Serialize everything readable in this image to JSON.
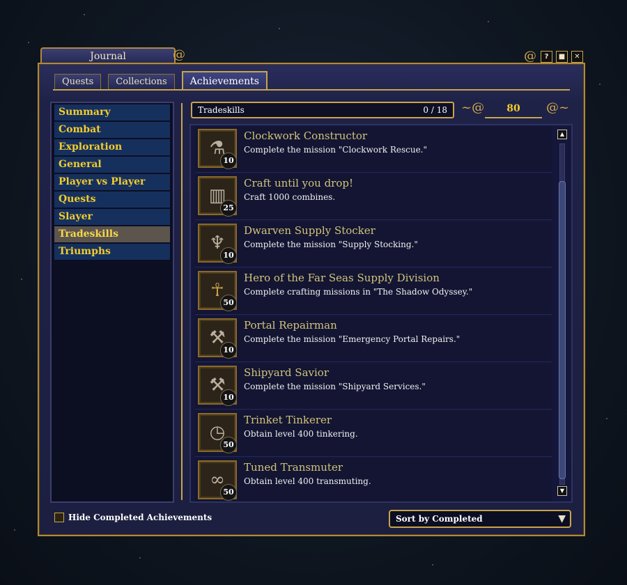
{
  "window": {
    "title": "Journal",
    "buttons": [
      "?",
      "■",
      "✕"
    ]
  },
  "tabs": [
    {
      "label": "Quests"
    },
    {
      "label": "Collections"
    },
    {
      "label": "Achievements",
      "active": true
    }
  ],
  "sidebar": {
    "items": [
      {
        "label": "Summary"
      },
      {
        "label": "Combat"
      },
      {
        "label": "Exploration"
      },
      {
        "label": "General"
      },
      {
        "label": "Player vs Player"
      },
      {
        "label": "Quests"
      },
      {
        "label": "Slayer"
      },
      {
        "label": "Tradeskills",
        "active": true
      },
      {
        "label": "Triumphs"
      }
    ]
  },
  "category": {
    "name": "Tradeskills",
    "progress": "0 / 18"
  },
  "points": "80",
  "achievements": [
    {
      "title": "Clockwork Constructor",
      "description": "Complete the mission \"Clockwork Rescue.\"",
      "points": "10",
      "icon": "vial-icon"
    },
    {
      "title": "Craft until you drop!",
      "description": "Craft 1000 combines.",
      "points": "25",
      "icon": "cabinet-icon"
    },
    {
      "title": "Dwarven Supply Stocker",
      "description": "Complete the mission \"Supply Stocking.\"",
      "points": "10",
      "icon": "lantern-icon"
    },
    {
      "title": "Hero of the Far Seas Supply Division",
      "description": "Complete crafting missions in \"The Shadow Odyssey.\"",
      "points": "50",
      "icon": "hooded-figure-icon"
    },
    {
      "title": "Portal Repairman",
      "description": "Complete the mission \"Emergency Portal Repairs.\"",
      "points": "10",
      "icon": "tools-icon"
    },
    {
      "title": "Shipyard Savior",
      "description": "Complete the mission \"Shipyard Services.\"",
      "points": "10",
      "icon": "hammer-icon"
    },
    {
      "title": "Trinket Tinkerer",
      "description": "Obtain level 400 tinkering.",
      "points": "50",
      "icon": "clock-icon"
    },
    {
      "title": "Tuned Transmuter",
      "description": "Obtain level 400 transmuting.",
      "points": "50",
      "icon": "orbs-icon"
    }
  ],
  "footer": {
    "hide_completed_label": "Hide Completed Achievements",
    "sort_label": "Sort by Completed"
  },
  "colors": {
    "gold": "#c9a54c",
    "sidebar_text": "#f2cc2c",
    "achievement_title": "#d2c47a"
  }
}
